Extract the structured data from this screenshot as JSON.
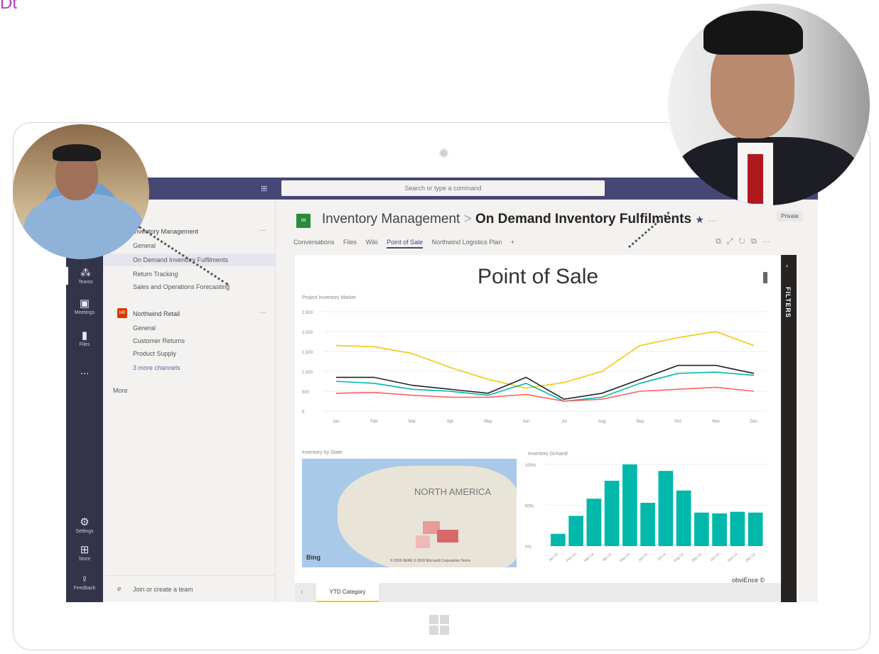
{
  "brand_glyph": "Dt",
  "app": {
    "search_placeholder": "Search or type a command"
  },
  "rail": {
    "items": [
      {
        "label": "Teams",
        "icon": "teams-icon"
      },
      {
        "label": "Meetings",
        "icon": "meetings-icon"
      },
      {
        "label": "Files",
        "icon": "files-icon"
      },
      {
        "label": "...",
        "icon": "more-icon"
      },
      {
        "label": "Settings",
        "icon": "settings-icon"
      },
      {
        "label": "Store",
        "icon": "store-icon"
      },
      {
        "label": "Feedback",
        "icon": "feedback-icon"
      }
    ]
  },
  "sidebar": {
    "team1": {
      "name": "Inventory Management",
      "channels": [
        "General",
        "On Demand Inventory Fulfilments",
        "Return Tracking",
        "Sales and Operations Forecasting"
      ]
    },
    "team2": {
      "badge": "NR",
      "name": "Northwind Retail",
      "channels": [
        "General",
        "Customer Returns",
        "Product Supply"
      ],
      "more_channels": "3 more channels"
    },
    "more": "More",
    "join": "Join or create a team"
  },
  "header": {
    "logo": "IM",
    "team": "Inventory Management",
    "separator": ">",
    "channel": "On Demand Inventory Fulfilments",
    "star": "★",
    "ellipsis": "···",
    "badge": "Private",
    "tabs": [
      "Conversations",
      "Files",
      "Wiki",
      "Point of Sale",
      "Northwind Logistics Plan",
      "+"
    ],
    "active_tab": "Point of Sale"
  },
  "report": {
    "title": "Point of Sale",
    "filters_label": "FILTERS",
    "map_title": "Inventory by State",
    "map_label": "NORTH AMERICA",
    "map_attribution": "Bing",
    "map_copyright": "© 2018 HERE © 2018 Microsoft Corporation Terms",
    "credit": "obviEnce ©",
    "bottom_tab": "YTD Category"
  },
  "chart_data": [
    {
      "type": "line",
      "title": "Project Inventory Market",
      "categories": [
        "Jan",
        "Feb",
        "Mar",
        "Apr",
        "May",
        "Jun",
        "Jul",
        "Aug",
        "Sep",
        "Oct",
        "Nov",
        "Dec"
      ],
      "yticks": [
        "0",
        "500",
        "1,000",
        "1,500",
        "2,000",
        "2,500"
      ],
      "ylim": [
        0,
        2500
      ],
      "series": [
        {
          "color": "#f2c811",
          "values": [
            1650,
            1620,
            1450,
            1100,
            800,
            580,
            720,
            1000,
            1650,
            1850,
            2000,
            1650
          ]
        },
        {
          "color": "#252423",
          "values": [
            850,
            850,
            650,
            550,
            450,
            850,
            300,
            450,
            800,
            1150,
            1150,
            950
          ]
        },
        {
          "color": "#01b8aa",
          "values": [
            750,
            700,
            550,
            500,
            400,
            700,
            250,
            350,
            700,
            950,
            980,
            900
          ]
        },
        {
          "color": "#fd625e",
          "values": [
            450,
            470,
            400,
            350,
            350,
            420,
            250,
            300,
            500,
            550,
            600,
            500
          ]
        }
      ]
    },
    {
      "type": "bar",
      "title": "Inventory Onhand",
      "categories": [
        "Jan-14",
        "Feb-14",
        "Mar-14",
        "Apr-14",
        "May-14",
        "Jun-14",
        "Jul-14",
        "Aug-14",
        "Sep-14",
        "Oct-14",
        "Nov-14",
        "Dec-14"
      ],
      "yticks": [
        "0%",
        "50%",
        "100%"
      ],
      "ylim": [
        0,
        100
      ],
      "values": [
        15,
        37,
        58,
        80,
        100,
        53,
        92,
        68,
        41,
        40,
        42,
        41
      ],
      "color": "#01b8aa"
    }
  ]
}
